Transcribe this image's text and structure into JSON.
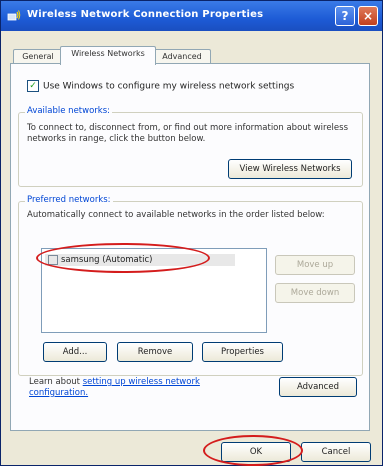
{
  "window": {
    "title": "Wireless Network Connection Properties",
    "help_label": "?",
    "close_label": "×"
  },
  "tabs": [
    {
      "label": "General"
    },
    {
      "label": "Wireless Networks"
    },
    {
      "label": "Advanced"
    }
  ],
  "use_windows": {
    "label": "Use Windows to configure my wireless network settings",
    "checked": true
  },
  "available": {
    "title": "Available networks:",
    "description": "To connect to, disconnect from, or find out more information about wireless networks in range, click the button below.",
    "view_button": "View Wireless Networks"
  },
  "preferred": {
    "title": "Preferred networks:",
    "description": "Automatically connect to available networks in the order listed below:",
    "items": [
      "samsung (Automatic)"
    ],
    "move_up": "Move up",
    "move_down": "Move down",
    "add_button": "Add...",
    "remove_button": "Remove",
    "properties_button": "Properties"
  },
  "footer": {
    "learn_about": "Learn about",
    "link_text": "setting up wireless network configuration.",
    "advanced_button": "Advanced"
  },
  "buttons": {
    "ok": "OK",
    "cancel": "Cancel"
  },
  "colors": {
    "annotation_ring": "#d41c1c",
    "titlebar": "#1d5bd6"
  }
}
